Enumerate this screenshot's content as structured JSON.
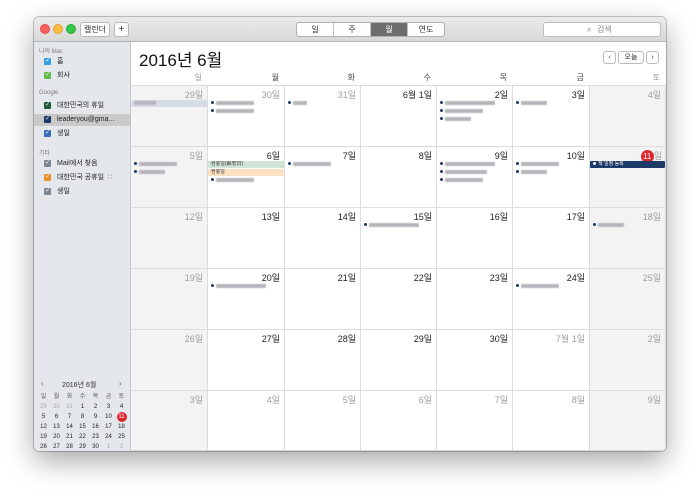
{
  "toolbar": {
    "calendars_button": "캘린더",
    "add_button": "+",
    "view_tabs": [
      {
        "label": "일",
        "active": false
      },
      {
        "label": "주",
        "active": false
      },
      {
        "label": "월",
        "active": true
      },
      {
        "label": "연도",
        "active": false
      }
    ],
    "search_placeholder": "검색",
    "search_icon": "magnifier-icon"
  },
  "sidebar": {
    "groups": [
      {
        "title": "나의 Mac",
        "items": [
          {
            "name": "홈",
            "color": "#34a0df",
            "checked": true,
            "selected": false
          },
          {
            "name": "회사",
            "color": "#64bb4a",
            "checked": true,
            "selected": false
          }
        ]
      },
      {
        "title": "Google",
        "items": [
          {
            "name": "대한민국의 휴일",
            "color": "#1f5a3b",
            "checked": true,
            "selected": false
          },
          {
            "name": "leaderyou@gma...",
            "color": "#1c3a68",
            "checked": true,
            "selected": true
          },
          {
            "name": "생일",
            "color": "#3a6db5",
            "checked": true,
            "selected": false
          }
        ]
      },
      {
        "title": "기타",
        "items": [
          {
            "name": "Mail에서 찾음",
            "color": "#7d8791",
            "checked": true,
            "selected": false
          },
          {
            "name": "대한민국 공휴일",
            "color": "#e8902b",
            "checked": true,
            "selected": false,
            "icon": "wifi-icon"
          },
          {
            "name": "생일",
            "color": "#7d8791",
            "checked": true,
            "selected": false
          }
        ]
      }
    ],
    "mini_calendar": {
      "title": "2016년 6월",
      "weekdays": [
        "일",
        "월",
        "화",
        "수",
        "목",
        "금",
        "토"
      ],
      "days": [
        [
          "29",
          "30",
          "31",
          "1",
          "2",
          "3",
          "4"
        ],
        [
          "5",
          "6",
          "7",
          "8",
          "9",
          "10",
          "11"
        ],
        [
          "12",
          "13",
          "14",
          "15",
          "16",
          "17",
          "18"
        ],
        [
          "19",
          "20",
          "21",
          "22",
          "23",
          "24",
          "25"
        ],
        [
          "26",
          "27",
          "28",
          "29",
          "30",
          "1",
          "2"
        ],
        [
          "3",
          "4",
          "5",
          "6",
          "7",
          "8",
          "9"
        ]
      ],
      "today": "11"
    }
  },
  "main": {
    "title": "2016년 6월",
    "today_button": "오늘",
    "weekdays": [
      "일",
      "월",
      "화",
      "수",
      "목",
      "금",
      "토"
    ],
    "weeks": [
      [
        {
          "label": "29일",
          "other": true,
          "events": [
            {
              "text": "아빠생신",
              "type": "bar",
              "bg": "#d7dbe3",
              "blur": true
            }
          ]
        },
        {
          "label": "30일",
          "other": true,
          "events": [
            {
              "text": "서울권관련 약속",
              "blur": true,
              "dot": "#1c3a68"
            },
            {
              "text": "회의 일정 공유",
              "blur": true,
              "dot": "#1c3a68"
            }
          ]
        },
        {
          "label": "31일",
          "other": true,
          "events": [
            {
              "text": "약속",
              "blur": true,
              "dot": "#1c3a68"
            }
          ]
        },
        {
          "label": "6월 1일",
          "other": false,
          "events": []
        },
        {
          "label": "2일",
          "other": false,
          "events": [
            {
              "text": "서울 강남 미팅 약속",
              "blur": true,
              "dot": "#1c3a68"
            },
            {
              "text": "출장 관련 업무",
              "blur": true,
              "dot": "#1c3a68"
            },
            {
              "text": "저녁 식사",
              "blur": true,
              "dot": "#1c3a68"
            }
          ]
        },
        {
          "label": "3일",
          "other": false,
          "events": [
            {
              "text": "점심 약속",
              "blur": true,
              "dot": "#1c3a68"
            }
          ]
        },
        {
          "label": "4일",
          "other": false,
          "events": []
        }
      ],
      [
        {
          "label": "5일",
          "other": false,
          "events": [
            {
              "text": "가족 모임 약속",
              "blur": true,
              "dot": "#1c3a68"
            },
            {
              "text": "서울 일정",
              "blur": true,
              "dot": "#1c3a68"
            }
          ]
        },
        {
          "label": "6일",
          "other": false,
          "events": [
            {
              "text": "현충일(顯忠日)",
              "type": "bar",
              "bg": "#cfe3d6",
              "blur": false
            },
            {
              "text": "현충일",
              "type": "bar",
              "bg": "#fbe0c2",
              "blur": false
            },
            {
              "text": "서울 일정 공유",
              "blur": true,
              "dot": "#1c3a68"
            }
          ]
        },
        {
          "label": "7일",
          "other": false,
          "events": [
            {
              "text": "업무 회의 안건",
              "blur": true,
              "dot": "#1c3a68"
            }
          ]
        },
        {
          "label": "8일",
          "other": false,
          "events": []
        },
        {
          "label": "9일",
          "other": false,
          "events": [
            {
              "text": "강남 미팅 약속 장소",
              "blur": true,
              "dot": "#1c3a68"
            },
            {
              "text": "사무실 업무 정리",
              "blur": true,
              "dot": "#1c3a68"
            },
            {
              "text": "저녁 모임 약속",
              "blur": true,
              "dot": "#1c3a68"
            }
          ]
        },
        {
          "label": "10일",
          "other": false,
          "events": [
            {
              "text": "업무 일정 관리",
              "blur": true,
              "dot": "#1c3a68"
            },
            {
              "text": "점심 약속",
              "blur": true,
              "dot": "#1c3a68"
            }
          ]
        },
        {
          "label": "11일",
          "other": false,
          "today": true,
          "events": [
            {
              "text": "책 일정 등록",
              "type": "bar",
              "bg": "#1c3a68",
              "color": "#ffffff",
              "blur": false,
              "dot": "#ffffff"
            }
          ]
        }
      ],
      [
        {
          "label": "12일",
          "other": false,
          "events": []
        },
        {
          "label": "13일",
          "other": false,
          "events": []
        },
        {
          "label": "14일",
          "other": false,
          "events": []
        },
        {
          "label": "15일",
          "other": false,
          "events": [
            {
              "text": "회사 업무 관련 회의",
              "blur": true,
              "dot": "#1c3a68"
            }
          ]
        },
        {
          "label": "16일",
          "other": false,
          "events": []
        },
        {
          "label": "17일",
          "other": false,
          "events": []
        },
        {
          "label": "18일",
          "other": false,
          "events": [
            {
              "text": "주말 약속",
              "blur": true,
              "dot": "#1c3a68"
            }
          ]
        }
      ],
      [
        {
          "label": "19일",
          "other": false,
          "events": []
        },
        {
          "label": "20일",
          "other": false,
          "events": [
            {
              "text": "업무 미팅 관련 약속",
              "blur": true,
              "dot": "#1c3a68"
            }
          ]
        },
        {
          "label": "21일",
          "other": false,
          "events": []
        },
        {
          "label": "22일",
          "other": false,
          "events": []
        },
        {
          "label": "23일",
          "other": false,
          "events": []
        },
        {
          "label": "24일",
          "other": false,
          "events": [
            {
              "text": "서울 출장 업무",
              "blur": true,
              "dot": "#1c3a68"
            }
          ]
        },
        {
          "label": "25일",
          "other": false,
          "events": []
        }
      ],
      [
        {
          "label": "26일",
          "other": false,
          "events": []
        },
        {
          "label": "27일",
          "other": false,
          "events": []
        },
        {
          "label": "28일",
          "other": false,
          "events": []
        },
        {
          "label": "29일",
          "other": false,
          "events": []
        },
        {
          "label": "30일",
          "other": false,
          "events": []
        },
        {
          "label": "7월 1일",
          "other": true,
          "events": []
        },
        {
          "label": "2일",
          "other": true,
          "events": []
        }
      ],
      [
        {
          "label": "3일",
          "other": true,
          "events": []
        },
        {
          "label": "4일",
          "other": true,
          "events": []
        },
        {
          "label": "5일",
          "other": true,
          "events": []
        },
        {
          "label": "6일",
          "other": true,
          "events": []
        },
        {
          "label": "7일",
          "other": true,
          "events": []
        },
        {
          "label": "8일",
          "other": true,
          "events": []
        },
        {
          "label": "9일",
          "other": true,
          "events": []
        }
      ]
    ]
  }
}
